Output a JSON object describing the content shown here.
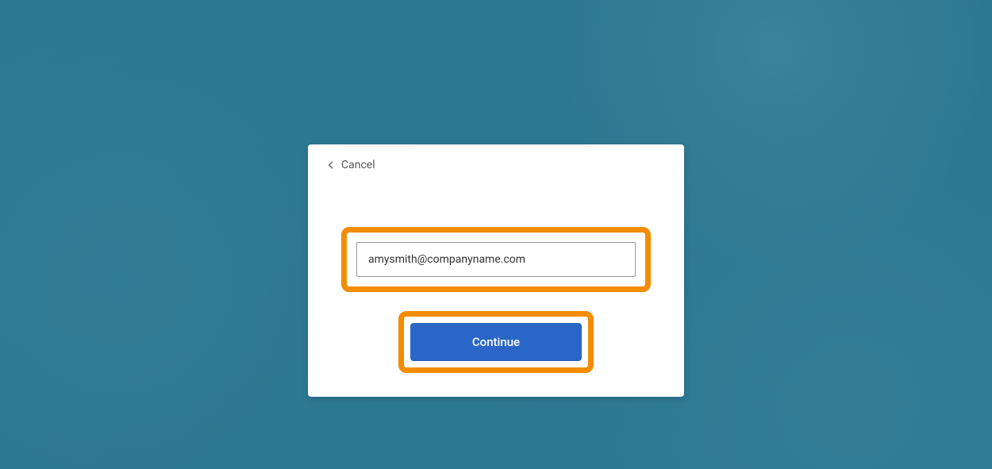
{
  "dialog": {
    "cancel_label": "Cancel",
    "email_value": "amysmith@companyname.com",
    "continue_label": "Continue"
  },
  "colors": {
    "highlight_border": "#f28c00",
    "primary_button_bg": "#2a66c7",
    "overlay_teal": "#2e7a94"
  },
  "highlights": [
    "email-input",
    "continue-button"
  ]
}
